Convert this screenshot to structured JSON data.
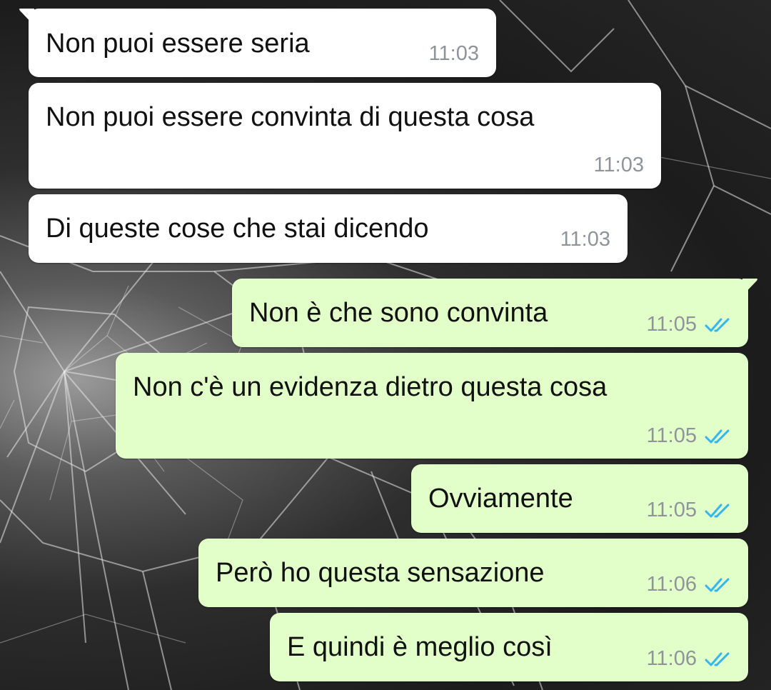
{
  "messages": [
    {
      "direction": "incoming",
      "text": "Non puoi essere seria",
      "time": "11:03"
    },
    {
      "direction": "incoming",
      "text": "Non puoi essere convinta di questa cosa",
      "time": "11:03"
    },
    {
      "direction": "incoming",
      "text": "Di queste cose che stai dicendo",
      "time": "11:03"
    },
    {
      "direction": "outgoing",
      "text": "Non è che sono convinta",
      "time": "11:05",
      "status_icon": "double-check-read-icon"
    },
    {
      "direction": "outgoing",
      "text": "Non c'è un evidenza dietro questa cosa",
      "time": "11:05",
      "status_icon": "double-check-read-icon"
    },
    {
      "direction": "outgoing",
      "text": "Ovviamente",
      "time": "11:05",
      "status_icon": "double-check-read-icon"
    },
    {
      "direction": "outgoing",
      "text": "Però ho questa sensazione",
      "time": "11:06",
      "status_icon": "double-check-read-icon"
    },
    {
      "direction": "outgoing",
      "text": "E quindi è meglio così",
      "time": "11:06",
      "status_icon": "double-check-read-icon"
    }
  ],
  "colors": {
    "incoming_bubble": "#ffffff",
    "outgoing_bubble": "#e2ffc9",
    "timestamp": "#8f949a",
    "read_ticks": "#34b7f1",
    "wallpaper": "#2a2a2a"
  },
  "wallpaper": "cracked-glass"
}
